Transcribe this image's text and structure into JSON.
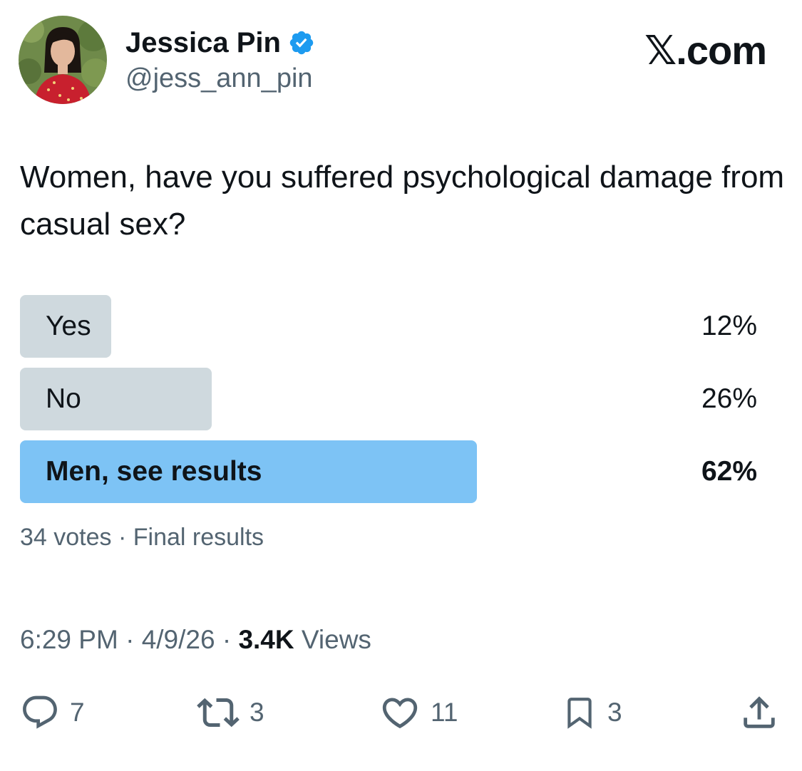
{
  "author": {
    "display_name": "Jessica Pin",
    "handle": "@jess_ann_pin",
    "verified_icon": "verified-badge-icon",
    "verified_color": "#1d9bf0"
  },
  "brand": {
    "label": "𝕏.com"
  },
  "tweet": {
    "text": "Women, have you suffered psychological damage from casual sex?"
  },
  "poll": {
    "options": [
      {
        "label": "Yes",
        "percent_label": "12%",
        "percent": 12
      },
      {
        "label": "No",
        "percent_label": "26%",
        "percent": 26
      },
      {
        "label": "Men, see results",
        "percent_label": "62%",
        "percent": 62
      }
    ],
    "meta": "34 votes · Final results",
    "bar_color": "#cfd9de",
    "winner_bar_color": "#7dc3f5"
  },
  "timestamp": {
    "time": "6:29 PM",
    "date": "4/9/26",
    "views_count": "3.4K",
    "views_label": "Views"
  },
  "actions": {
    "replies": "7",
    "reposts": "3",
    "likes": "11",
    "bookmarks": "3"
  }
}
